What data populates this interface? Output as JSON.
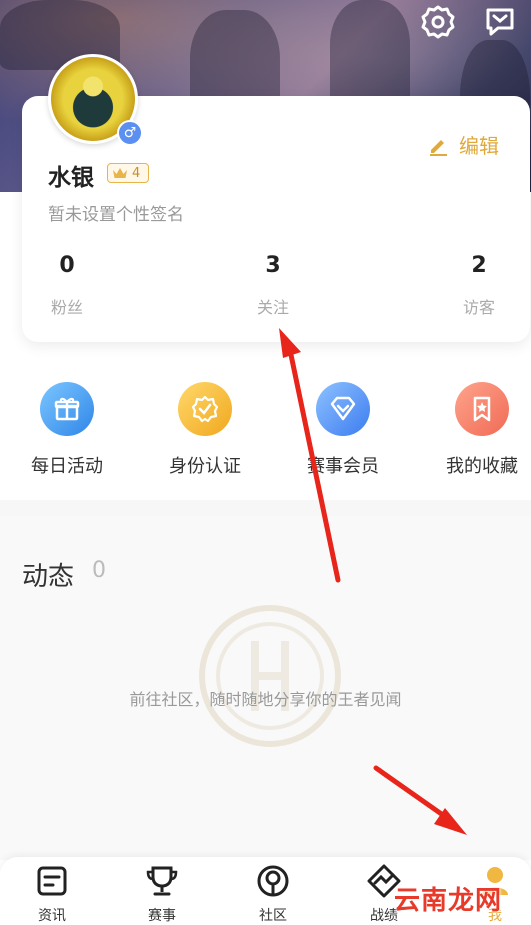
{
  "profile": {
    "username": "水银",
    "level": "4",
    "signature": "暂未设置个性签名",
    "edit_label": "编辑",
    "gender_symbol": "♂",
    "stats": [
      {
        "count": "0",
        "label": "粉丝"
      },
      {
        "count": "3",
        "label": "关注"
      },
      {
        "count": "2",
        "label": "访客"
      }
    ]
  },
  "shortcuts": [
    {
      "label": "每日活动",
      "icon": "gift-icon"
    },
    {
      "label": "身份认证",
      "icon": "verified-badge-icon"
    },
    {
      "label": "赛事会员",
      "icon": "diamond-icon"
    },
    {
      "label": "我的收藏",
      "icon": "bookmark-star-icon"
    }
  ],
  "feed": {
    "title": "动态",
    "count": "0",
    "empty_text": "前往社区，随时随地分享你的王者见闻"
  },
  "tabs": [
    {
      "label": "资讯",
      "icon": "news-icon"
    },
    {
      "label": "赛事",
      "icon": "trophy-icon"
    },
    {
      "label": "社区",
      "icon": "community-icon"
    },
    {
      "label": "战绩",
      "icon": "stats-chart-icon"
    },
    {
      "label": "我",
      "icon": "profile-icon",
      "active": true
    }
  ],
  "watermark": "云南龙网",
  "colors": {
    "accent": "#e0a93b",
    "annotation_arrow": "#e8251a"
  }
}
